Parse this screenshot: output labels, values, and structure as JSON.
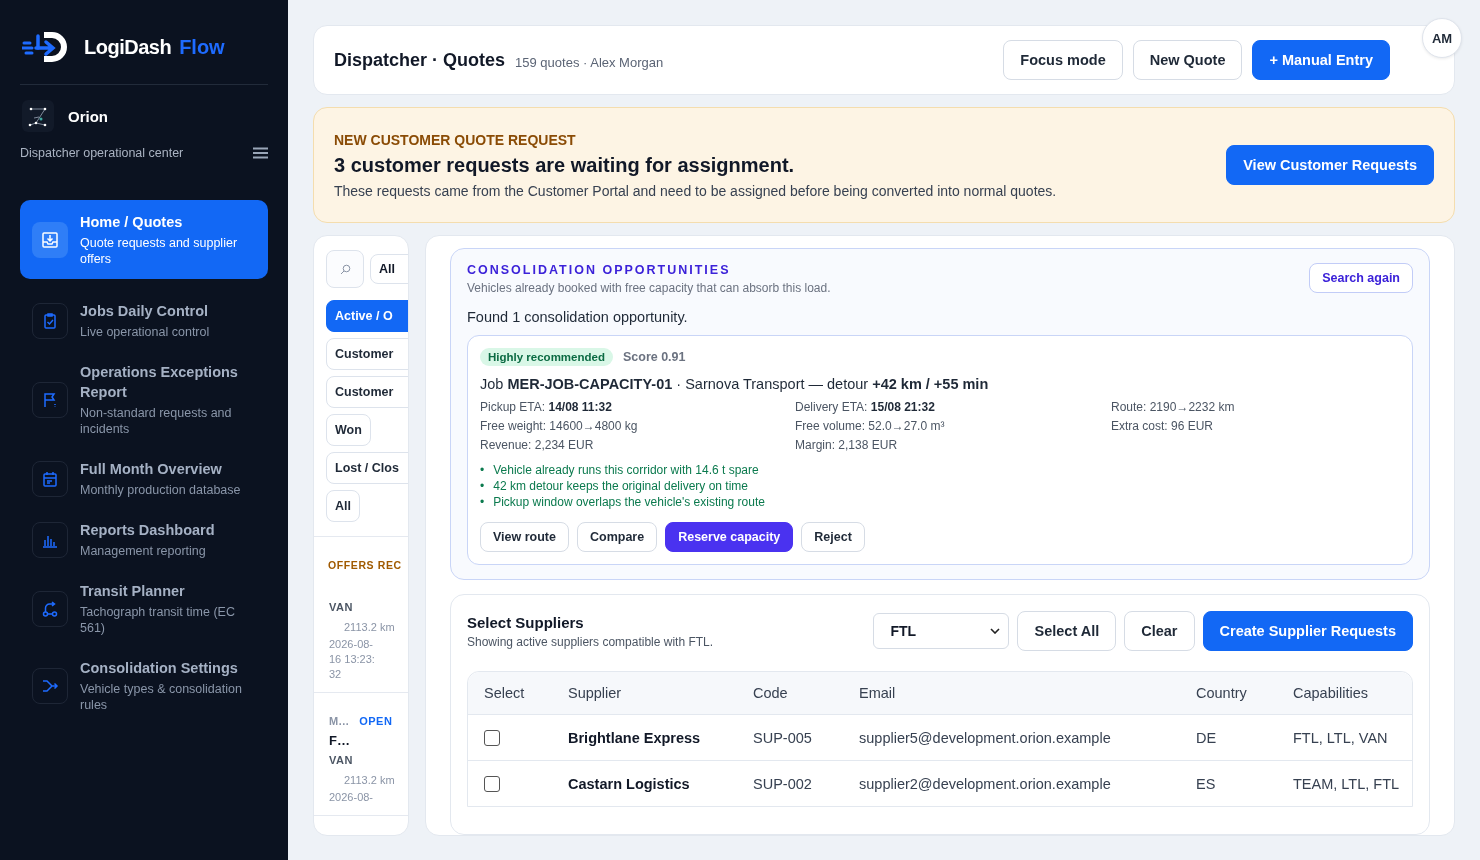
{
  "sidebar": {
    "brand": {
      "name": "LogiDash",
      "accent": "Flow"
    },
    "workspace": {
      "name": "Orion",
      "subtitle": "Dispatcher operational center"
    },
    "nav": [
      {
        "title": "Home / Quotes",
        "subtitle": "Quote requests and supplier offers",
        "kind": "inbox",
        "selected": true
      },
      {
        "title": "Jobs Daily Control",
        "subtitle": "Live operational control",
        "kind": "clipboard",
        "selected": false
      },
      {
        "title": "Operations Exceptions Report",
        "subtitle": "Non-standard requests and incidents",
        "kind": "flag",
        "selected": false
      },
      {
        "title": "Full Month Overview",
        "subtitle": "Monthly production database",
        "kind": "calendar",
        "selected": false
      },
      {
        "title": "Reports Dashboard",
        "subtitle": "Management reporting",
        "kind": "bars",
        "selected": false
      },
      {
        "title": "Transit Planner",
        "subtitle": "Tachograph transit time (EC 561)",
        "kind": "route",
        "selected": false
      },
      {
        "title": "Consolidation Settings",
        "subtitle": "Vehicle types & consolidation rules",
        "kind": "merge",
        "selected": false
      }
    ]
  },
  "header": {
    "title": "Dispatcher · Quotes",
    "meta": "159 quotes · Alex Morgan",
    "buttons": [
      {
        "label": "Focus mode",
        "kind": "outline"
      },
      {
        "label": "New Quote",
        "kind": "outline"
      },
      {
        "label": "+ Manual Entry",
        "kind": "primary"
      }
    ],
    "avatar": "AM"
  },
  "banner": {
    "eyebrow": "NEW CUSTOMER QUOTE REQUEST",
    "heading": "3 customer requests are waiting for assignment.",
    "text": "These requests came from the Customer Portal and need to be assigned before being converted into normal quotes.",
    "button": "View Customer Requests"
  },
  "filters": {
    "scope": "All",
    "chips": [
      {
        "label": "Active / O",
        "selected": true
      },
      {
        "label": "Customer",
        "selected": false
      },
      {
        "label": "Customer",
        "selected": false
      },
      {
        "label": "Won",
        "selected": false
      },
      {
        "label": "Lost / Clos",
        "selected": false
      },
      {
        "label": "All",
        "selected": false
      }
    ],
    "offers_title": "OFFERS REC",
    "cards": [
      {
        "vehicle": "VAN",
        "distance": "2113.2 km",
        "date": "2026-08-16 13:23:32"
      },
      {
        "code": "M…",
        "status": "OPEN",
        "name": "F…",
        "vehicle": "VAN",
        "distance": "2113.2 km",
        "date": "2026-08-"
      }
    ]
  },
  "consolidation": {
    "title": "CONSOLIDATION OPPORTUNITIES",
    "subtitle": "Vehicles already booked with free capacity that can absorb this load.",
    "button": "Search again",
    "found": "Found 1 consolidation opportunity.",
    "opportunity": {
      "badge": "Highly recommended",
      "score": "Score 0.91",
      "job": "Job **MER-JOB-CAPACITY-01** · Sarnova Transport — detour **+42 km / +55 min**",
      "details": [
        "Pickup ETA: **14/08 11:32**",
        "Delivery ETA: **15/08 21:32**",
        "Route: 2190→2232 km",
        "Free weight: 14600→4800 kg",
        "Free volume: 52.0→27.0 m³",
        "Extra cost: 96 EUR",
        "Revenue: 2,234 EUR",
        "Margin: 2,138 EUR"
      ],
      "marker": "•",
      "reasons": [
        "Vehicle already runs this corridor with 14.6 t spare",
        "42 km detour keeps the original delivery on time",
        "Pickup window overlaps the vehicle's existing route"
      ],
      "actions": [
        {
          "label": "View route",
          "kind": "outline"
        },
        {
          "label": "Compare",
          "kind": "outline"
        },
        {
          "label": "Reserve capacity",
          "kind": "primary"
        },
        {
          "label": "Reject",
          "kind": "outline"
        }
      ]
    }
  },
  "suppliers": {
    "title": "Select Suppliers",
    "subtitle": "Showing active suppliers compatible with FTL.",
    "filter": "FTL",
    "buttons": [
      {
        "label": "Select All",
        "kind": "outline"
      },
      {
        "label": "Clear",
        "kind": "outline"
      },
      {
        "label": "Create Supplier Requests",
        "kind": "primary"
      }
    ],
    "columns": [
      "Select",
      "Supplier",
      "Code",
      "Email",
      "Country",
      "Capabilities"
    ],
    "rows": [
      {
        "checked": false,
        "supplier": "Brightlane Express",
        "code": "SUP-005",
        "email": "supplier5@development.orion.example",
        "country": "DE",
        "capabilities": "FTL, LTL, VAN"
      },
      {
        "checked": false,
        "supplier": "Castarn Logistics",
        "code": "SUP-002",
        "email": "supplier2@development.orion.example",
        "country": "ES",
        "capabilities": "TEAM, LTL, FTL"
      }
    ]
  }
}
